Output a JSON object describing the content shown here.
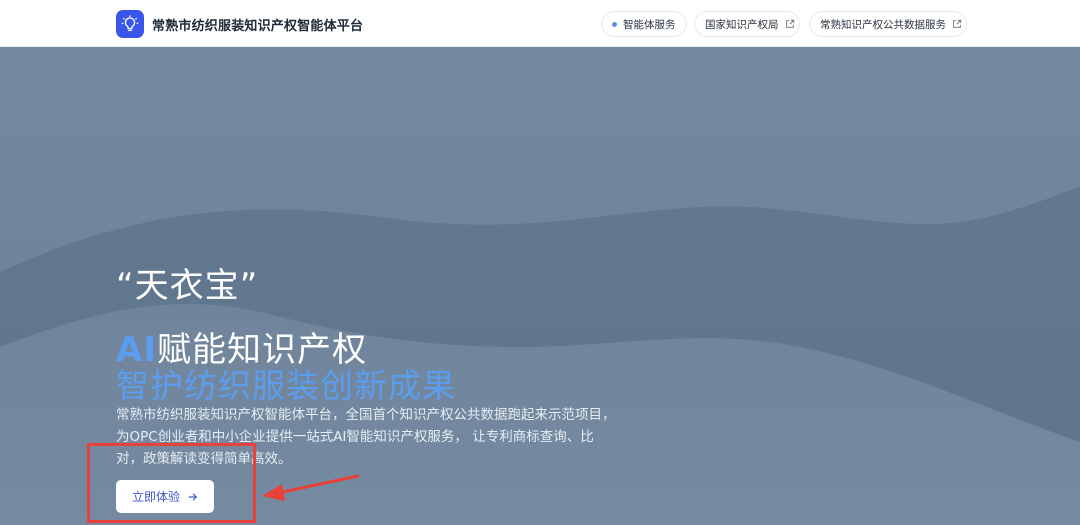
{
  "header": {
    "logo_icon": "lightbulb-icon",
    "title": "常熟市纺织服装知识产权智能体平台",
    "nav": [
      {
        "label": "智能体服务",
        "icon": "dot-icon"
      },
      {
        "label": "国家知识产权局",
        "icon": "external-link-icon"
      },
      {
        "label": "常熟知识产权公共数据服务",
        "icon": "external-link-icon"
      }
    ]
  },
  "hero": {
    "slogan": "“天衣宝”",
    "headline_ai": "AI",
    "headline_rest": "赋能知识产权",
    "headline_2": "智护纺织服装创新成果",
    "description": "常熟市纺织服装知识产权智能体平台，全国首个知识产权公共数据跑起来示范项目，为OPC创业者和中小企业提供一站式AI智能知识产权服务， 让专利商标查询、比对，政策解读变得简单高效。",
    "cta_label": "立即体验",
    "cta_icon": "arrow-right-icon"
  },
  "colors": {
    "brand": "#3a56e8",
    "accent_blue": "#5b9ef0",
    "hero_bg": "#6f8599",
    "annotation_red": "#e8413a"
  }
}
